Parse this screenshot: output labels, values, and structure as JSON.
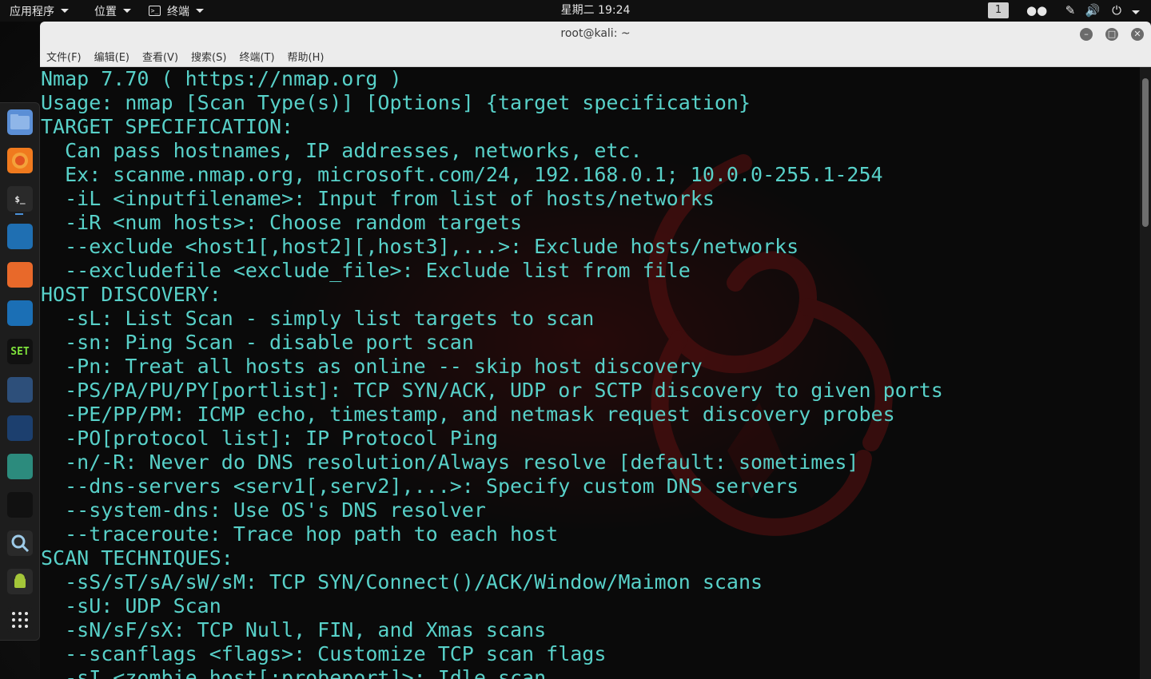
{
  "top_panel": {
    "apps_menu": "应用程序",
    "places_menu": "位置",
    "terminal_menu": "终端",
    "clock": "星期二 19:24",
    "workspace": "1"
  },
  "window": {
    "title": "root@kali: ~",
    "menu": [
      "文件(F)",
      "编辑(E)",
      "查看(V)",
      "搜索(S)",
      "终端(T)",
      "帮助(H)"
    ]
  },
  "dock": {
    "items": [
      {
        "name": "files-icon",
        "color": "#5b8fd6"
      },
      {
        "name": "firefox-icon",
        "color": "#f07a1e"
      },
      {
        "name": "terminal-icon",
        "color": "#2a2a2a"
      },
      {
        "name": "metasploit-icon",
        "color": "#1f6fb2"
      },
      {
        "name": "burpsuite-icon",
        "color": "#e8692a"
      },
      {
        "name": "wireshark-icon",
        "color": "#1b6fb5"
      },
      {
        "name": "set-icon",
        "color": "#111111",
        "label": "SET"
      },
      {
        "name": "maltego-icon",
        "color": "#2d4f7a"
      },
      {
        "name": "beef-icon",
        "color": "#1c3f6e"
      },
      {
        "name": "armitage-icon",
        "color": "#2c8b7d"
      },
      {
        "name": "cutycapt-icon",
        "color": "#111111"
      },
      {
        "name": "searchsploit-icon",
        "color": "#2a2a2a"
      },
      {
        "name": "android-icon",
        "color": "#2a2a2a"
      },
      {
        "name": "show-apps-icon",
        "color": "#1d1d1d"
      }
    ]
  },
  "terminal": {
    "lines": [
      "Nmap 7.70 ( https://nmap.org )",
      "Usage: nmap [Scan Type(s)] [Options] {target specification}",
      "TARGET SPECIFICATION:",
      "  Can pass hostnames, IP addresses, networks, etc.",
      "  Ex: scanme.nmap.org, microsoft.com/24, 192.168.0.1; 10.0.0-255.1-254",
      "  -iL <inputfilename>: Input from list of hosts/networks",
      "  -iR <num hosts>: Choose random targets",
      "  --exclude <host1[,host2][,host3],...>: Exclude hosts/networks",
      "  --excludefile <exclude_file>: Exclude list from file",
      "HOST DISCOVERY:",
      "  -sL: List Scan - simply list targets to scan",
      "  -sn: Ping Scan - disable port scan",
      "  -Pn: Treat all hosts as online -- skip host discovery",
      "  -PS/PA/PU/PY[portlist]: TCP SYN/ACK, UDP or SCTP discovery to given ports",
      "  -PE/PP/PM: ICMP echo, timestamp, and netmask request discovery probes",
      "  -PO[protocol list]: IP Protocol Ping",
      "  -n/-R: Never do DNS resolution/Always resolve [default: sometimes]",
      "  --dns-servers <serv1[,serv2],...>: Specify custom DNS servers",
      "  --system-dns: Use OS's DNS resolver",
      "  --traceroute: Trace hop path to each host",
      "SCAN TECHNIQUES:",
      "  -sS/sT/sA/sW/sM: TCP SYN/Connect()/ACK/Window/Maimon scans",
      "  -sU: UDP Scan",
      "  -sN/sF/sX: TCP Null, FIN, and Xmas scans",
      "  --scanflags <flags>: Customize TCP scan flags",
      "  -sI <zombie host[:probeport]>: Idle scan"
    ],
    "text_color": "#58d1c9"
  }
}
